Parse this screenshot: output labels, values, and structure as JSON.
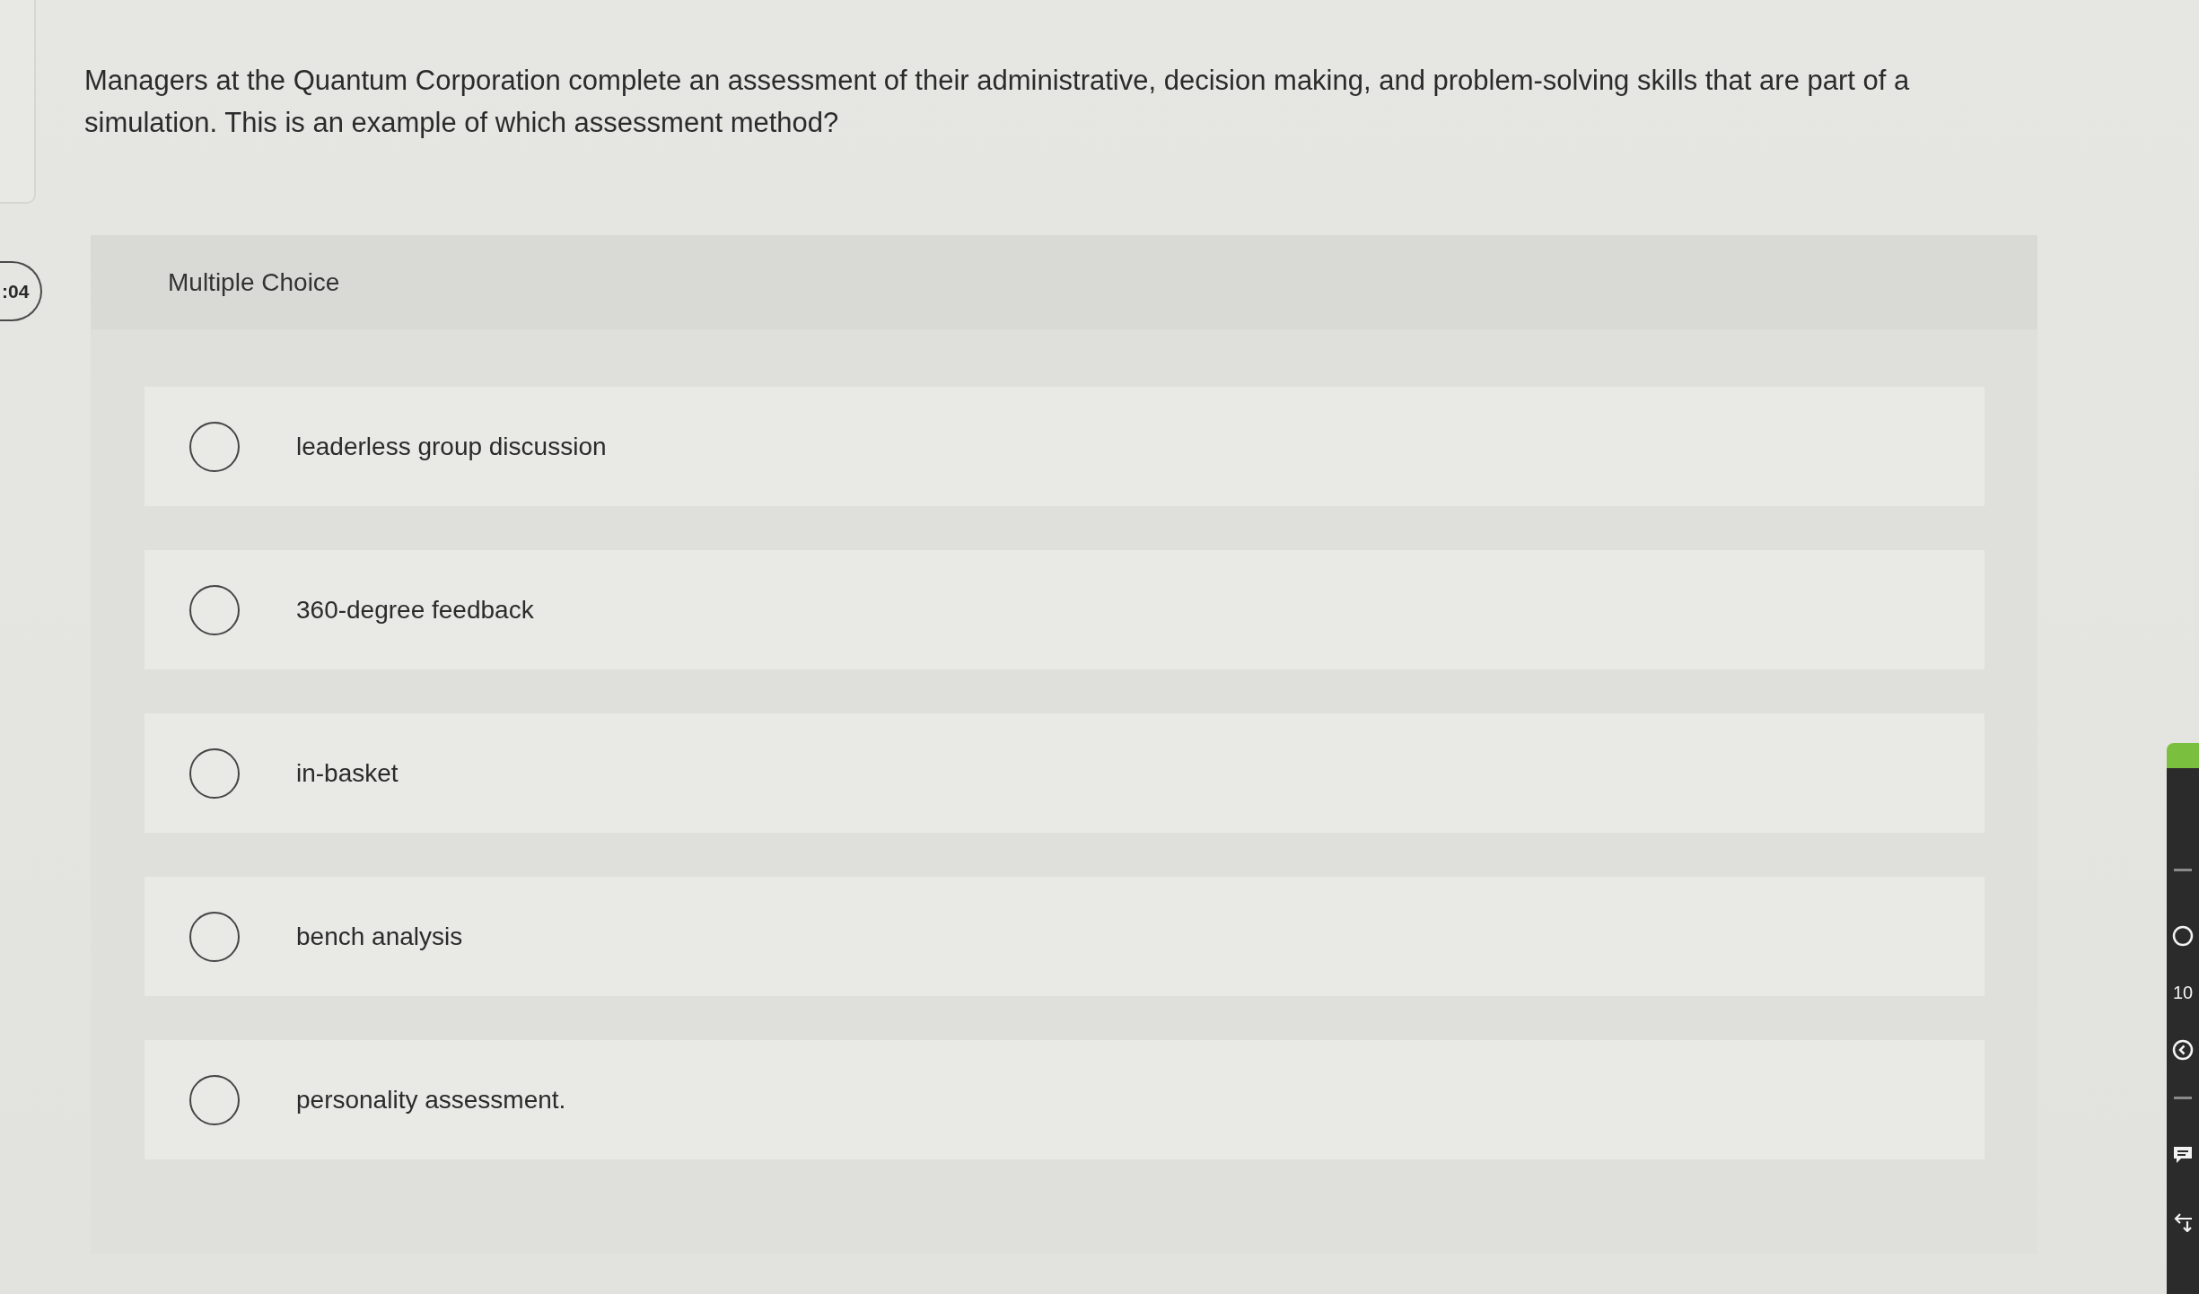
{
  "timer": {
    "text": ":04"
  },
  "question": {
    "text": "Managers at the Quantum Corporation complete an assessment of their administrative, decision making, and problem-solving skills that are part of a simulation. This is an example of which assessment method?"
  },
  "answer_panel": {
    "heading": "Multiple Choice",
    "options": [
      {
        "label": "leaderless group discussion",
        "selected": false
      },
      {
        "label": "360-degree feedback",
        "selected": false
      },
      {
        "label": "in-basket",
        "selected": false
      },
      {
        "label": "bench analysis",
        "selected": false
      },
      {
        "label": "personality assessment.",
        "selected": false
      }
    ]
  },
  "side_toolbar": {
    "count": "10"
  }
}
